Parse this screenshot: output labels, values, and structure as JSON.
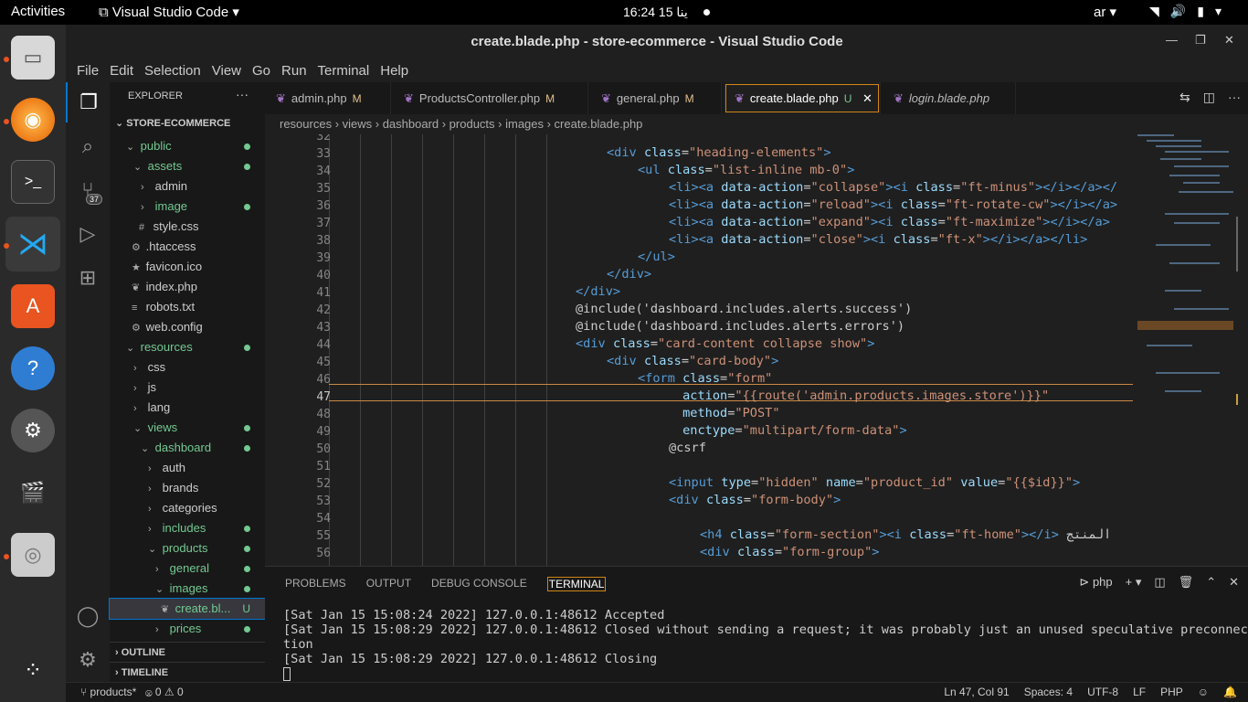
{
  "topbar": {
    "activities": "Activities",
    "app": "Visual Studio Code",
    "clock": "16:24  15 ينا",
    "lang": "ar"
  },
  "window": {
    "title": "create.blade.php - store-ecommerce - Visual Studio Code"
  },
  "menu": [
    "File",
    "Edit",
    "Selection",
    "View",
    "Go",
    "Run",
    "Terminal",
    "Help"
  ],
  "activity": {
    "badge": "37"
  },
  "explorer": {
    "header": "EXPLORER",
    "root": "STORE-ECOMMERCE",
    "tree": [
      {
        "label": "public",
        "ch": "⌄",
        "indent": 18,
        "git": true,
        "cls": "grn"
      },
      {
        "label": "assets",
        "ch": "⌄",
        "indent": 26,
        "git": true,
        "cls": "grn"
      },
      {
        "label": "admin",
        "ch": "›",
        "indent": 34,
        "git": false,
        "cls": ""
      },
      {
        "label": "image",
        "ch": "›",
        "indent": 34,
        "git": true,
        "cls": "grn"
      },
      {
        "label": "style.css",
        "ch": "#",
        "indent": 32,
        "git": false,
        "cls": ""
      },
      {
        "label": ".htaccess",
        "ch": "⚙",
        "indent": 24,
        "git": false,
        "cls": ""
      },
      {
        "label": "favicon.ico",
        "ch": "★",
        "indent": 24,
        "git": false,
        "cls": ""
      },
      {
        "label": "index.php",
        "ch": "❦",
        "indent": 24,
        "git": false,
        "cls": ""
      },
      {
        "label": "robots.txt",
        "ch": "≡",
        "indent": 24,
        "git": false,
        "cls": ""
      },
      {
        "label": "web.config",
        "ch": "⚙",
        "indent": 24,
        "git": false,
        "cls": ""
      },
      {
        "label": "resources",
        "ch": "⌄",
        "indent": 18,
        "git": true,
        "cls": "grn"
      },
      {
        "label": "css",
        "ch": "›",
        "indent": 26,
        "git": false,
        "cls": ""
      },
      {
        "label": "js",
        "ch": "›",
        "indent": 26,
        "git": false,
        "cls": ""
      },
      {
        "label": "lang",
        "ch": "›",
        "indent": 26,
        "git": false,
        "cls": ""
      },
      {
        "label": "views",
        "ch": "⌄",
        "indent": 26,
        "git": true,
        "cls": "grn"
      },
      {
        "label": "dashboard",
        "ch": "⌄",
        "indent": 34,
        "git": true,
        "cls": "grn"
      },
      {
        "label": "auth",
        "ch": "›",
        "indent": 42,
        "git": false,
        "cls": ""
      },
      {
        "label": "brands",
        "ch": "›",
        "indent": 42,
        "git": false,
        "cls": ""
      },
      {
        "label": "categories",
        "ch": "›",
        "indent": 42,
        "git": false,
        "cls": ""
      },
      {
        "label": "includes",
        "ch": "›",
        "indent": 42,
        "git": true,
        "cls": "grn"
      },
      {
        "label": "products",
        "ch": "⌄",
        "indent": 42,
        "git": true,
        "cls": "grn"
      },
      {
        "label": "general",
        "ch": "›",
        "indent": 50,
        "git": true,
        "cls": "grn"
      },
      {
        "label": "images",
        "ch": "⌄",
        "indent": 50,
        "git": true,
        "cls": "grn"
      },
      {
        "label": "create.bl...",
        "ch": "❦",
        "indent": 56,
        "git": false,
        "cls": "grn sel",
        "u": "U"
      },
      {
        "label": "prices",
        "ch": "›",
        "indent": 50,
        "git": true,
        "cls": "grn"
      }
    ],
    "outline": "OUTLINE",
    "timeline": "TIMELINE"
  },
  "tabs": [
    {
      "label": "admin.php",
      "mark": "M",
      "active": false
    },
    {
      "label": "ProductsController.php",
      "mark": "M",
      "active": false
    },
    {
      "label": "general.php",
      "mark": "M",
      "active": false
    },
    {
      "label": "create.blade.php",
      "mark": "U",
      "active": true
    },
    {
      "label": "login.blade.php",
      "mark": "",
      "active": false
    }
  ],
  "breadcrumbs": "resources › views › dashboard › products › images › create.blade.php",
  "editor": {
    "current_line": "47",
    "lines": [
      {
        "n": "32",
        "i": 0,
        "h": ""
      },
      {
        "n": "33",
        "i": 3,
        "h": "<span class='tag'>&lt;div</span> <span class='att'>class</span>=<span class='str'>\"heading-elements\"</span><span class='tag'>&gt;</span>"
      },
      {
        "n": "34",
        "i": 4,
        "h": "<span class='tag'>&lt;ul</span> <span class='att'>class</span>=<span class='str'>\"list-inline mb-0\"</span><span class='tag'>&gt;</span>"
      },
      {
        "n": "35",
        "i": 5,
        "h": "<span class='tag'>&lt;li&gt;&lt;a</span> <span class='att'>data-action</span>=<span class='str'>\"collapse\"</span><span class='tag'>&gt;&lt;i</span> <span class='att'>class</span>=<span class='str'>\"ft-minus\"</span><span class='tag'>&gt;&lt;/i&gt;&lt;/a&gt;&lt;/</span>"
      },
      {
        "n": "36",
        "i": 5,
        "h": "<span class='tag'>&lt;li&gt;&lt;a</span> <span class='att'>data-action</span>=<span class='str'>\"reload\"</span><span class='tag'>&gt;&lt;i</span> <span class='att'>class</span>=<span class='str'>\"ft-rotate-cw\"</span><span class='tag'>&gt;&lt;/i&gt;&lt;/a&gt;</span>"
      },
      {
        "n": "37",
        "i": 5,
        "h": "<span class='tag'>&lt;li&gt;&lt;a</span> <span class='att'>data-action</span>=<span class='str'>\"expand\"</span><span class='tag'>&gt;&lt;i</span> <span class='att'>class</span>=<span class='str'>\"ft-maximize\"</span><span class='tag'>&gt;&lt;/i&gt;&lt;/a&gt;</span>"
      },
      {
        "n": "38",
        "i": 5,
        "h": "<span class='tag'>&lt;li&gt;&lt;a</span> <span class='att'>data-action</span>=<span class='str'>\"close\"</span><span class='tag'>&gt;&lt;i</span> <span class='att'>class</span>=<span class='str'>\"ft-x\"</span><span class='tag'>&gt;&lt;/i&gt;&lt;/a&gt;&lt;/li&gt;</span>"
      },
      {
        "n": "39",
        "i": 4,
        "h": "<span class='tag'>&lt;/ul&gt;</span>"
      },
      {
        "n": "40",
        "i": 3,
        "h": "<span class='tag'>&lt;/div&gt;</span>"
      },
      {
        "n": "41",
        "i": 2,
        "h": "<span class='tag'>&lt;/div&gt;</span>"
      },
      {
        "n": "42",
        "i": 2,
        "h": "<span class='txt'>@include('dashboard.includes.alerts.success')</span>"
      },
      {
        "n": "43",
        "i": 2,
        "h": "<span class='txt'>@include('dashboard.includes.alerts.errors')</span>"
      },
      {
        "n": "44",
        "i": 2,
        "h": "<span class='tag'>&lt;div</span> <span class='att'>class</span>=<span class='str'>\"card-content collapse show\"</span><span class='tag'>&gt;</span>"
      },
      {
        "n": "45",
        "i": 3,
        "h": "<span class='tag'>&lt;div</span> <span class='att'>class</span>=<span class='str'>\"card-body\"</span><span class='tag'>&gt;</span>"
      },
      {
        "n": "46",
        "i": 4,
        "h": "<span class='tag'>&lt;form</span> <span class='att'>class</span>=<span class='str'>\"form\"</span>"
      },
      {
        "n": "47",
        "i": 4,
        "h": "      <span class='att'>action</span>=<span class='str'>\"{{route('admin.products.images.store')}}\"</span>"
      },
      {
        "n": "48",
        "i": 4,
        "h": "      <span class='att'>method</span>=<span class='str'>\"POST\"</span>"
      },
      {
        "n": "49",
        "i": 4,
        "h": "      <span class='att'>enctype</span>=<span class='str'>\"multipart/form-data\"</span><span class='tag'>&gt;</span>"
      },
      {
        "n": "50",
        "i": 5,
        "h": "<span class='txt'>@csrf</span>"
      },
      {
        "n": "51",
        "i": 5,
        "h": ""
      },
      {
        "n": "52",
        "i": 5,
        "h": "<span class='tag'>&lt;input</span> <span class='att'>type</span>=<span class='str'>\"hidden\"</span> <span class='att'>name</span>=<span class='str'>\"product_id\"</span> <span class='att'>value</span>=<span class='str'>\"{{$id}}\"</span><span class='tag'>&gt;</span>"
      },
      {
        "n": "53",
        "i": 5,
        "h": "<span class='tag'>&lt;div</span> <span class='att'>class</span>=<span class='str'>\"form-body\"</span><span class='tag'>&gt;</span>"
      },
      {
        "n": "54",
        "i": 5,
        "h": ""
      },
      {
        "n": "55",
        "i": 6,
        "h": "<span class='tag'>&lt;h4</span> <span class='att'>class</span>=<span class='str'>\"form-section\"</span><span class='tag'>&gt;&lt;i</span> <span class='att'>class</span>=<span class='str'>\"ft-home\"</span><span class='tag'>&gt;&lt;/i&gt;</span> <span class='txt'>المنتج</span>"
      },
      {
        "n": "56",
        "i": 6,
        "h": "<span class='tag'>&lt;div</span> <span class='att'>class</span>=<span class='str'>\"form-group\"</span><span class='tag'>&gt;</span>"
      }
    ]
  },
  "panel": {
    "tabs": [
      "PROBLEMS",
      "OUTPUT",
      "DEBUG CONSOLE",
      "TERMINAL"
    ],
    "shell": "php",
    "terminal": [
      "[Sat Jan 15 15:08:24 2022] 127.0.0.1:48612 Accepted",
      "[Sat Jan 15 15:08:29 2022] 127.0.0.1:48612 Closed without sending a request; it was probably just an unused speculative preconnec",
      "tion",
      "[Sat Jan 15 15:08:29 2022] 127.0.0.1:48612 Closing"
    ]
  },
  "status": {
    "branch": "products*",
    "errors": "0",
    "warnings": "0",
    "position": "Ln 47, Col 91",
    "spaces": "Spaces: 4",
    "encoding": "UTF-8",
    "eol": "LF",
    "language": "PHP"
  }
}
